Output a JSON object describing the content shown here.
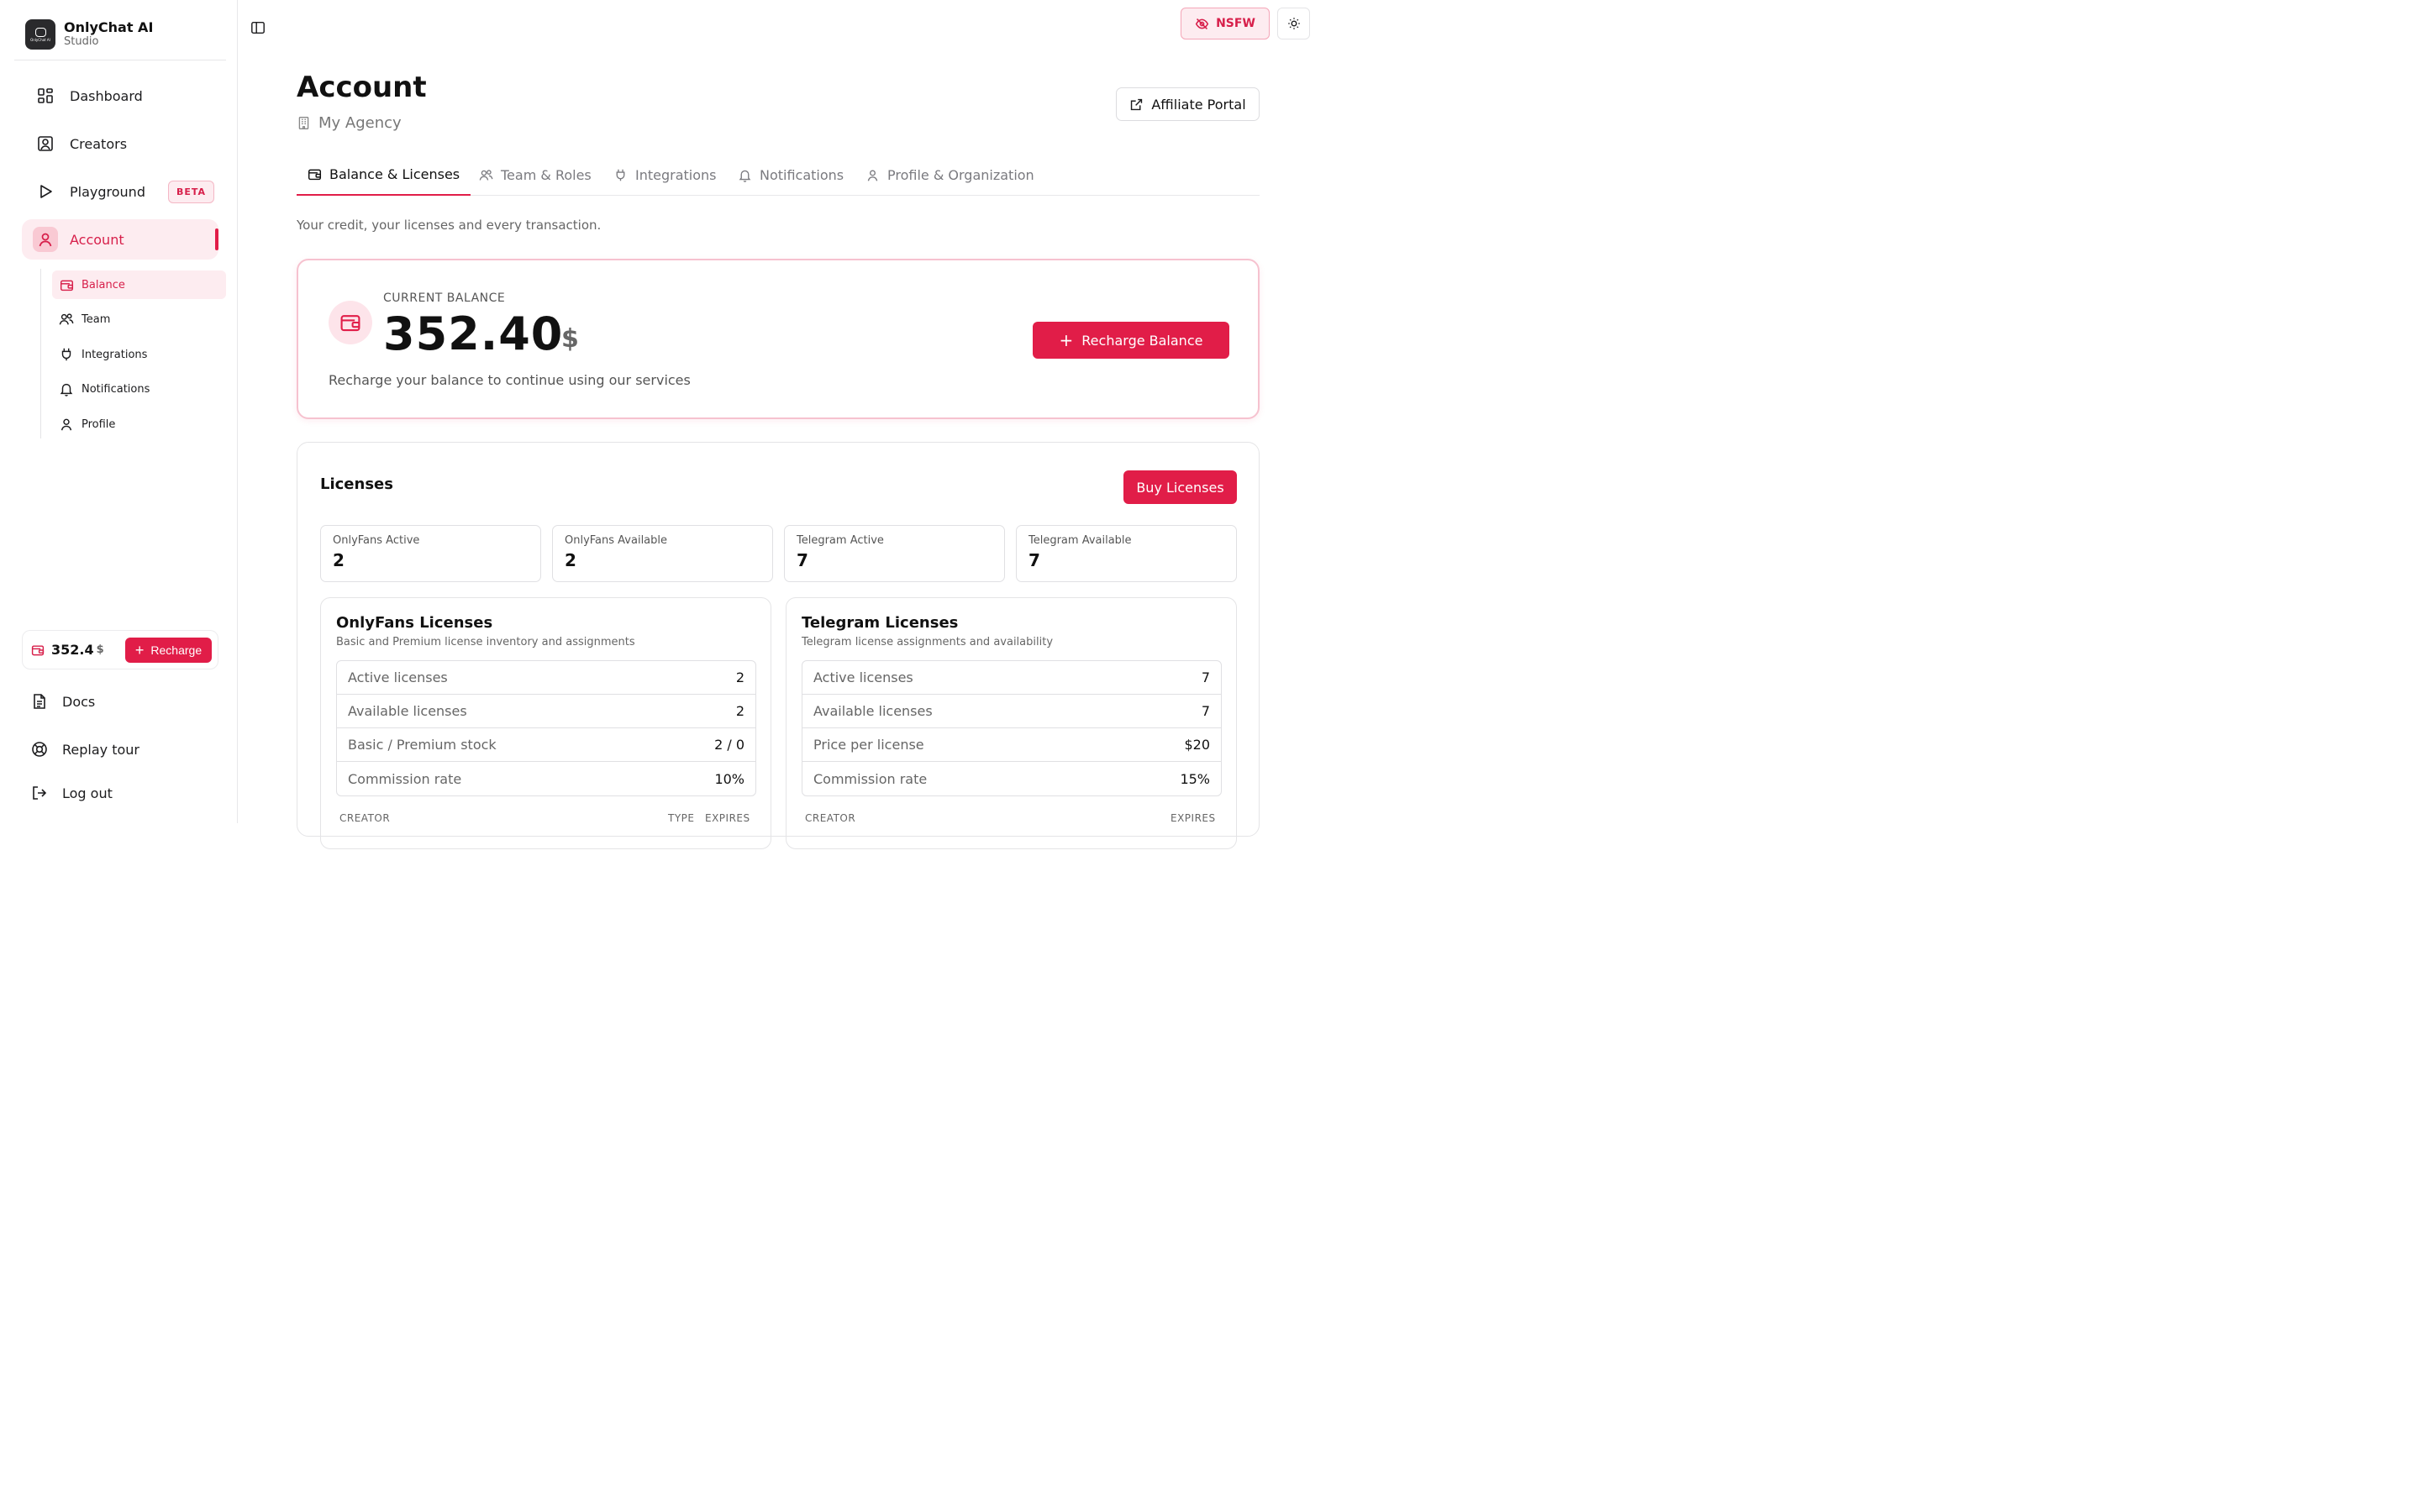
{
  "brand": {
    "title": "OnlyChat AI",
    "subtitle": "Studio",
    "logo_text": "OnlyChat AI"
  },
  "sidebar": {
    "items": [
      {
        "label": "Dashboard",
        "icon": "dashboard-icon"
      },
      {
        "label": "Creators",
        "icon": "user-square-icon"
      },
      {
        "label": "Playground",
        "icon": "play-icon",
        "badge": "BETA"
      },
      {
        "label": "Account",
        "icon": "user-icon"
      }
    ],
    "sub_items": [
      {
        "label": "Balance",
        "icon": "wallet-icon"
      },
      {
        "label": "Team",
        "icon": "users-icon"
      },
      {
        "label": "Integrations",
        "icon": "plug-icon"
      },
      {
        "label": "Notifications",
        "icon": "bell-icon"
      },
      {
        "label": "Profile",
        "icon": "user-icon"
      }
    ],
    "balance": {
      "amount": "352.4",
      "currency": "$",
      "recharge_label": "Recharge"
    },
    "bottom": [
      {
        "label": "Docs",
        "icon": "document-icon"
      },
      {
        "label": "Replay tour",
        "icon": "lifebuoy-icon"
      },
      {
        "label": "Log out",
        "icon": "logout-icon"
      }
    ]
  },
  "topbar": {
    "nsfw_label": "NSFW"
  },
  "header": {
    "title": "Account",
    "agency": "My Agency",
    "affiliate_label": "Affiliate Portal"
  },
  "tabs": [
    {
      "label": "Balance & Licenses",
      "active": true
    },
    {
      "label": "Team & Roles"
    },
    {
      "label": "Integrations"
    },
    {
      "label": "Notifications"
    },
    {
      "label": "Profile & Organization"
    }
  ],
  "intro": "Your credit, your licenses and every transaction.",
  "balance_card": {
    "label": "CURRENT BALANCE",
    "amount": "352.40",
    "currency": "$",
    "note": "Recharge your balance to continue using our services",
    "recharge_label": "Recharge Balance"
  },
  "licenses": {
    "title": "Licenses",
    "buy_label": "Buy Licenses",
    "stats": [
      {
        "label": "OnlyFans Active",
        "value": "2"
      },
      {
        "label": "OnlyFans Available",
        "value": "2"
      },
      {
        "label": "Telegram Active",
        "value": "7"
      },
      {
        "label": "Telegram Available",
        "value": "7"
      }
    ],
    "onlyfans": {
      "title": "OnlyFans Licenses",
      "desc": "Basic and Premium license inventory and assignments",
      "rows": [
        {
          "k": "Active licenses",
          "v": "2"
        },
        {
          "k": "Available licenses",
          "v": "2"
        },
        {
          "k": "Basic / Premium stock",
          "v": "2 / 0"
        },
        {
          "k": "Commission rate",
          "v": "10%"
        }
      ],
      "headers": [
        "CREATOR",
        "TYPE",
        "EXPIRES"
      ]
    },
    "telegram": {
      "title": "Telegram Licenses",
      "desc": "Telegram license assignments and availability",
      "rows": [
        {
          "k": "Active licenses",
          "v": "7"
        },
        {
          "k": "Available licenses",
          "v": "7"
        },
        {
          "k": "Price per license",
          "v": "$20"
        },
        {
          "k": "Commission rate",
          "v": "15%"
        }
      ],
      "headers": [
        "CREATOR",
        "EXPIRES"
      ]
    }
  },
  "colors": {
    "accent": "#e11d48",
    "accent_soft": "#fdecf0"
  }
}
